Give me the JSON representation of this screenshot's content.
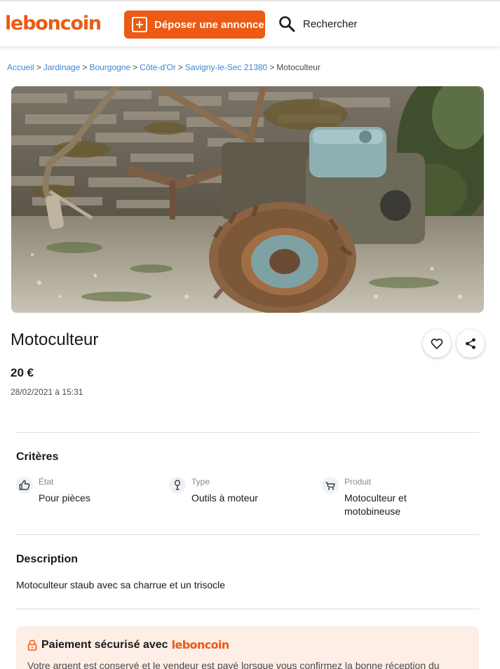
{
  "header": {
    "logo": "leboncoin",
    "deposit_label": "Déposer une annonce",
    "search_label": "Rechercher"
  },
  "breadcrumb": {
    "items": [
      "Accueil",
      "Jardinage",
      "Bourgogne",
      "Côte-d'Or",
      "Savigny-le-Sec 21380"
    ],
    "current": "Motoculteur",
    "separator": ">"
  },
  "listing": {
    "title": "Motoculteur",
    "price": "20 €",
    "date": "28/02/2021 à 15:31"
  },
  "criteria": {
    "title": "Critères",
    "items": [
      {
        "label": "État",
        "value": "Pour pièces",
        "icon": "thumbs-up-icon"
      },
      {
        "label": "Type",
        "value": "Outils à moteur",
        "icon": "shovel-icon"
      },
      {
        "label": "Produit",
        "value": "Motoculteur et motobineuse",
        "icon": "cart-icon"
      }
    ]
  },
  "description": {
    "title": "Description",
    "text": "Motoculteur staub avec sa charrue et un trisocle"
  },
  "payment": {
    "title": "Paiement sécurisé avec",
    "logo": "leboncoin",
    "text": "Votre argent est conservé et le vendeur est payé lorsque vous confirmez la bonne réception du"
  },
  "colors": {
    "brand": "#ec5a13",
    "link": "#4183d7",
    "payment_bg": "#fdeee6"
  }
}
